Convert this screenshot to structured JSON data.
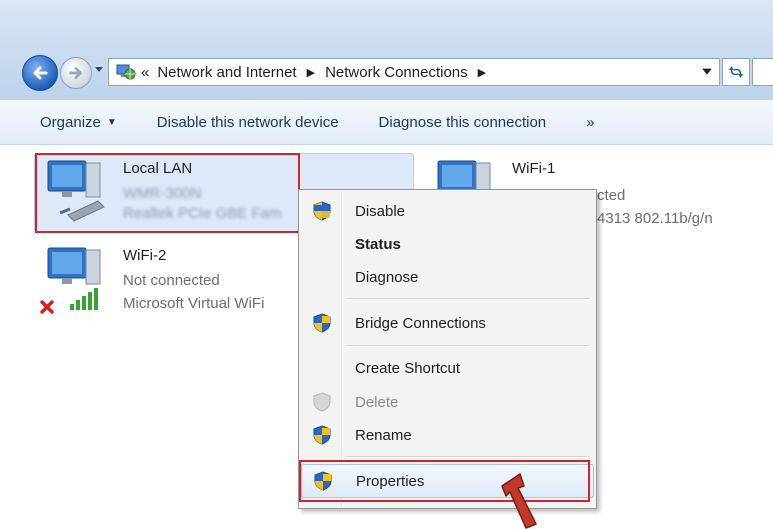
{
  "address": {
    "overflow_symbol": "«",
    "crumbs": [
      "Network and Internet",
      "Network Connections"
    ]
  },
  "toolbar": {
    "organize_label": "Organize",
    "disable_label": "Disable this network device",
    "diagnose_label": "Diagnose this connection",
    "more_label": "»"
  },
  "connections": {
    "local_lan": {
      "name": "Local LAN",
      "line1": "WMR-300N",
      "line2": "Realtek PCIe GBE Fam"
    },
    "wifi2": {
      "name": "WiFi-2",
      "status": "Not connected",
      "device": "Microsoft Virtual WiFi"
    },
    "wifi1": {
      "name": "WiFi-1",
      "status": "cted",
      "device": "4313 802.11b/g/n"
    }
  },
  "context_menu": {
    "items": [
      {
        "label": "Disable",
        "icon": "shield-icon"
      },
      {
        "label": "Status",
        "bold": true
      },
      {
        "label": "Diagnose"
      },
      {
        "label": "Bridge Connections",
        "icon": "shield-icon"
      },
      {
        "label": "Create Shortcut"
      },
      {
        "label": "Delete",
        "icon": "shield-icon",
        "disabled": true
      },
      {
        "label": "Rename",
        "icon": "shield-icon"
      },
      {
        "label": "Properties",
        "icon": "shield-icon",
        "highlighted": true
      }
    ]
  },
  "colors": {
    "highlight_box": "#d2232a",
    "selection_bg": "#dde9f8",
    "toolbar_text": "#1e3557",
    "arrow": "#c0392b"
  }
}
